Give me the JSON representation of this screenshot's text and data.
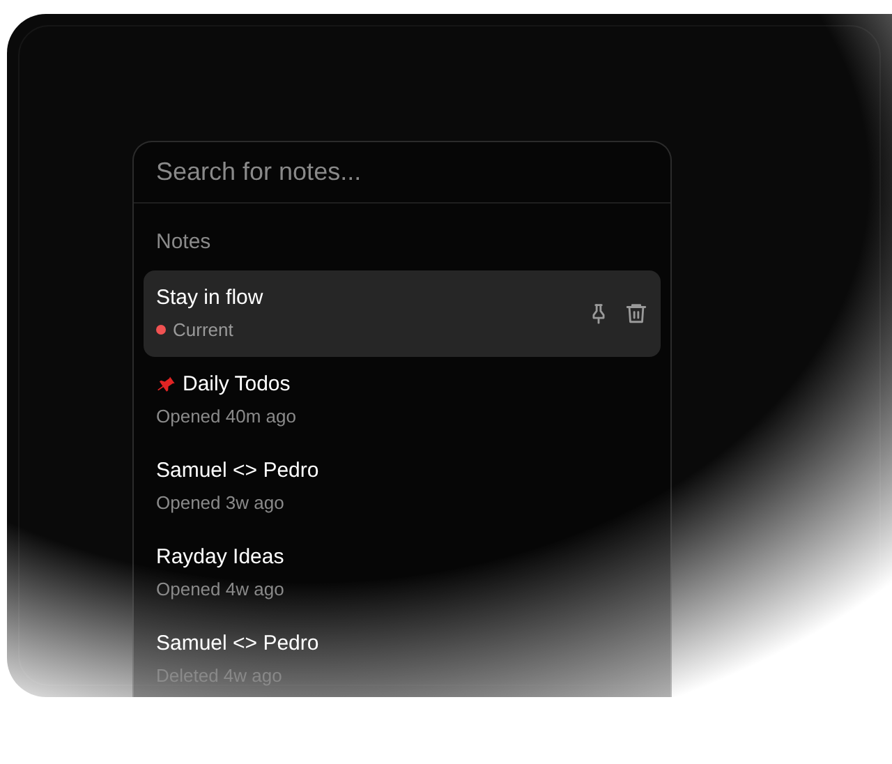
{
  "search": {
    "placeholder": "Search for notes..."
  },
  "section_title": "Notes",
  "notes": [
    {
      "title": "Stay in flow",
      "subtitle": "Current",
      "pinned": false,
      "selected": true,
      "color": "#f05252",
      "kind": "current"
    },
    {
      "title": "Daily Todos",
      "subtitle": "Opened 40m ago",
      "pinned": true,
      "selected": false,
      "kind": "opened"
    },
    {
      "title": "Samuel <> Pedro",
      "subtitle": "Opened 3w ago",
      "pinned": false,
      "selected": false,
      "kind": "opened"
    },
    {
      "title": "Rayday Ideas",
      "subtitle": "Opened 4w ago",
      "pinned": false,
      "selected": false,
      "kind": "opened"
    },
    {
      "title": "Samuel <> Pedro",
      "subtitle": "Deleted 4w ago",
      "pinned": false,
      "selected": false,
      "kind": "deleted"
    }
  ]
}
